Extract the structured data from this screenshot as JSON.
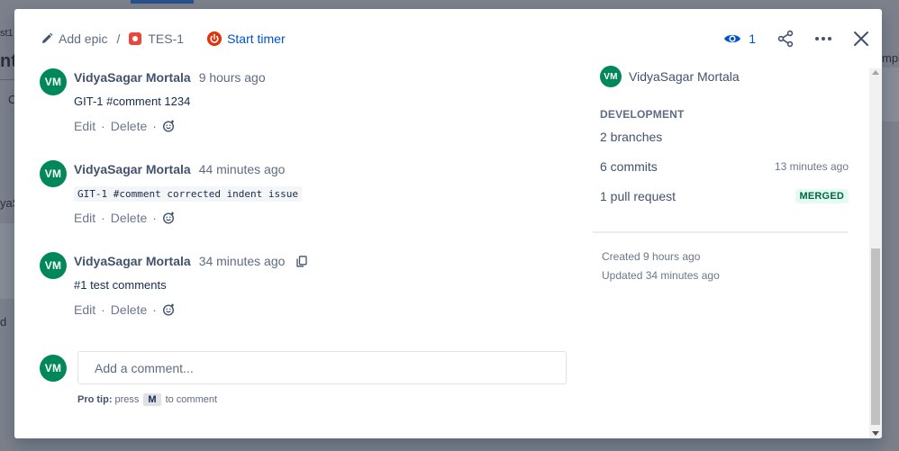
{
  "background": {
    "fragments": [
      "st1",
      "nt",
      "C",
      "yaS",
      "d",
      "mple"
    ]
  },
  "header": {
    "add_epic_label": "Add epic",
    "separator": "/",
    "issue_key": "TES-1",
    "start_timer_label": "Start timer",
    "watcher_count": "1"
  },
  "comments": [
    {
      "avatar_initials": "VM",
      "author": "VidyaSagar Mortala",
      "time": "9 hours ago",
      "body": "GIT-1 #comment 1234",
      "is_code": false
    },
    {
      "avatar_initials": "VM",
      "author": "VidyaSagar Mortala",
      "time": "44 minutes ago",
      "body": "GIT-1 #comment corrected indent issue",
      "is_code": true
    },
    {
      "avatar_initials": "VM",
      "author": "VidyaSagar Mortala",
      "time": "34 minutes ago",
      "body": "#1 test comments",
      "is_code": false
    }
  ],
  "comment_actions": {
    "edit": "Edit",
    "delete": "Delete",
    "separator": "·"
  },
  "add_comment": {
    "avatar_initials": "VM",
    "placeholder": "Add a comment...",
    "pro_tip_label": "Pro tip:",
    "pro_tip_press": "press",
    "pro_tip_key": "M",
    "pro_tip_suffix": "to comment"
  },
  "sidebar": {
    "assignee_initials": "VM",
    "assignee_name": "VidyaSagar Mortala",
    "development_title": "DEVELOPMENT",
    "branches": "2 branches",
    "commits": "6 commits",
    "commits_time": "13 minutes ago",
    "pull_requests": "1 pull request",
    "pr_status": "MERGED",
    "created": "Created 9 hours ago",
    "updated": "Updated 34 minutes ago"
  },
  "colors": {
    "accent": "#0052CC",
    "avatar": "#00875A",
    "merged_bg": "#E3FCEF",
    "merged_text": "#006644",
    "timer_icon": "#DE350B",
    "bug_icon": "#E5493A"
  }
}
